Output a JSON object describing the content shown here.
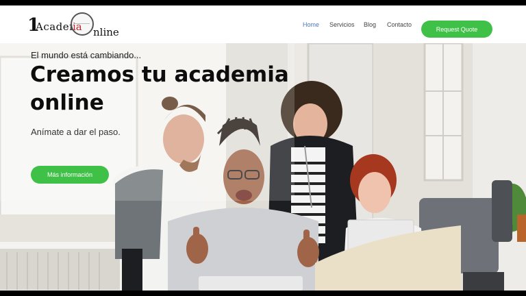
{
  "logo": {
    "digit": "1",
    "part1": "Academ",
    "part2": "ia",
    "part3": "nline"
  },
  "nav": {
    "home": "Home",
    "services": "Servicios",
    "blog": "Blog",
    "contact": "Contacto",
    "quote": "Request Quote"
  },
  "hero": {
    "eyebrow": "El mundo está cambiando...",
    "title": "Creamos tu academia online",
    "subtitle": "Anímate a dar el paso.",
    "cta": "Más información"
  },
  "colors": {
    "accent": "#3ec146",
    "nav_active": "#4a78c8",
    "logo_red": "#c0272d"
  }
}
